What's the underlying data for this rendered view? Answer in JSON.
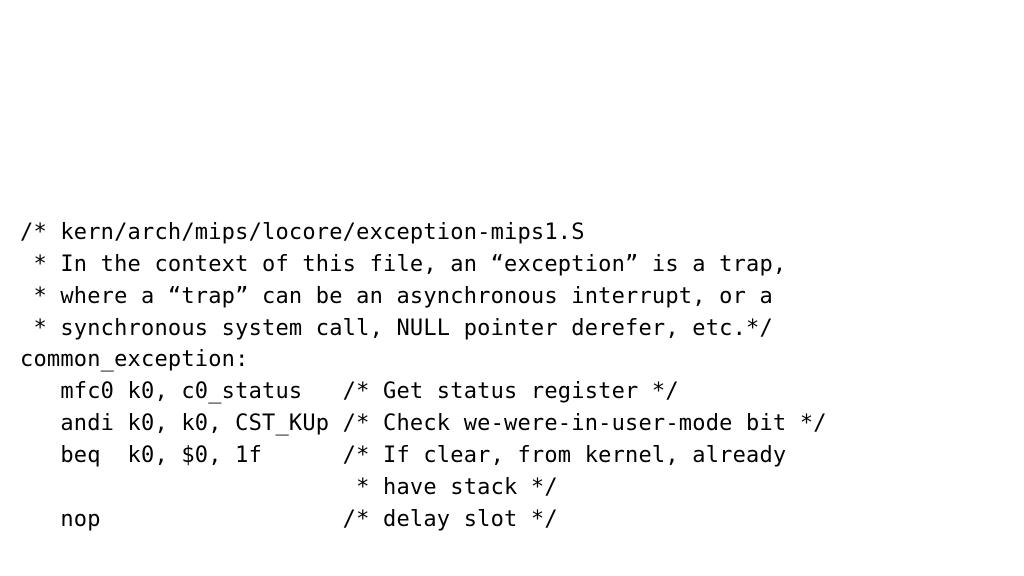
{
  "code": {
    "l0": "/* kern/arch/mips/locore/exception-mips1.S",
    "l1": " * In the context of this file, an “exception” is a trap,",
    "l2": " * where a “trap” can be an asynchronous interrupt, or a",
    "l3": " * synchronous system call, NULL pointer derefer, etc.*/",
    "l4": "common_exception:",
    "l5": "   mfc0 k0, c0_status   /* Get status register */",
    "l6": "   andi k0, k0, CST_KUp /* Check we-were-in-user-mode bit */",
    "l7": "   beq  k0, $0, 1f      /* If clear, from kernel, already",
    "l8": "                         * have stack */",
    "l9": "   nop                  /* delay slot */"
  }
}
